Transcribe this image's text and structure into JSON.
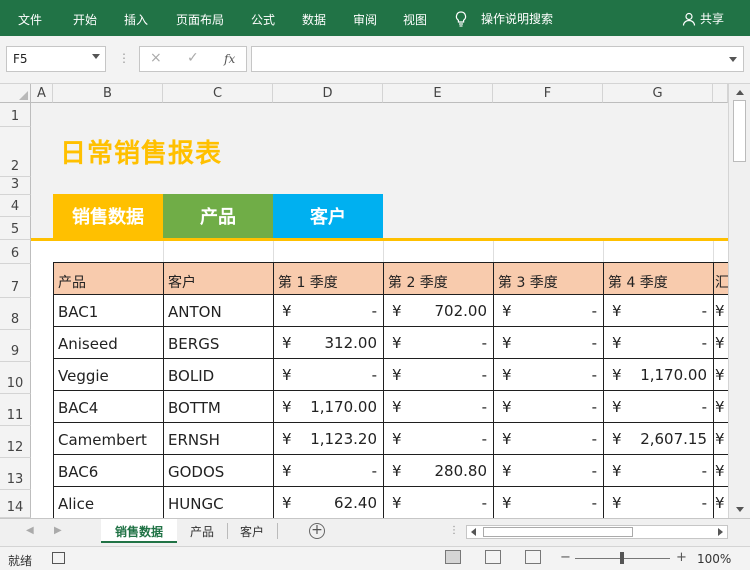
{
  "ribbon": {
    "tabs": [
      "文件",
      "开始",
      "插入",
      "页面布局",
      "公式",
      "数据",
      "审阅",
      "视图"
    ],
    "tell_me": "操作说明搜索",
    "share": "共享"
  },
  "formula_bar": {
    "name_box": "F5",
    "cancel_icon": "×",
    "enter_icon": "✓",
    "fx_label": "fx",
    "formula": ""
  },
  "columns": [
    "A",
    "B",
    "C",
    "D",
    "E",
    "F",
    "G"
  ],
  "rows": [
    "1",
    "2",
    "3",
    "4",
    "5",
    "6",
    "7",
    "8",
    "9",
    "10",
    "11",
    "12",
    "13",
    "14"
  ],
  "report": {
    "title": "日常销售报表",
    "nav_tabs": [
      {
        "label": "销售数据",
        "color": "#ffc000"
      },
      {
        "label": "产品",
        "color": "#70ad47"
      },
      {
        "label": "客户",
        "color": "#00b0f0"
      }
    ]
  },
  "table": {
    "headers": [
      "产品",
      "客户",
      "第 1 季度",
      "第 2 季度",
      "第 3 季度",
      "第 4 季度",
      "汇"
    ],
    "currency_symbol": "¥",
    "rows": [
      {
        "product": "BAC1",
        "customer": "ANTON",
        "q1": "-",
        "q2": "702.00",
        "q3": "-",
        "q4": "-"
      },
      {
        "product": "Aniseed",
        "customer": "BERGS",
        "q1": "312.00",
        "q2": "-",
        "q3": "-",
        "q4": "-"
      },
      {
        "product": "Veggie",
        "customer": "BOLID",
        "q1": "-",
        "q2": "-",
        "q3": "-",
        "q4": "1,170.00"
      },
      {
        "product": "BAC4",
        "customer": "BOTTM",
        "q1": "1,170.00",
        "q2": "-",
        "q3": "-",
        "q4": "-"
      },
      {
        "product": "Camembert",
        "customer": "ERNSH",
        "q1": "1,123.20",
        "q2": "-",
        "q3": "-",
        "q4": "2,607.15"
      },
      {
        "product": "BAC6",
        "customer": "GODOS",
        "q1": "-",
        "q2": "280.80",
        "q3": "-",
        "q4": "-"
      },
      {
        "product": "Alice",
        "customer": "HUNGC",
        "q1": "62.40",
        "q2": "-",
        "q3": "-",
        "q4": "-"
      }
    ]
  },
  "sheet_tabs": [
    "销售数据",
    "产品",
    "客户"
  ],
  "active_sheet": "销售数据",
  "status": {
    "ready": "就绪",
    "zoom": "100%"
  },
  "colors": {
    "ribbon": "#217346",
    "title": "#ffc000",
    "header_fill": "#f8cbad",
    "accent_line": "#ffc000"
  }
}
